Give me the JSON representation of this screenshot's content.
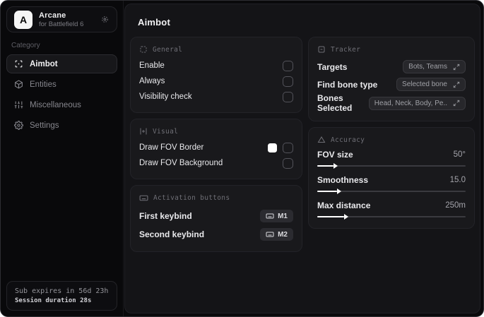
{
  "app": {
    "name": "Arcane",
    "subtitle": "for Battlefield 6",
    "logo_letter": "A"
  },
  "sidebar": {
    "category_label": "Category",
    "items": [
      {
        "label": "Aimbot",
        "icon": "crosshair-scan-icon",
        "active": true
      },
      {
        "label": "Entities",
        "icon": "cube-icon",
        "active": false
      },
      {
        "label": "Miscellaneous",
        "icon": "sliders-icon",
        "active": false
      },
      {
        "label": "Settings",
        "icon": "gear-icon",
        "active": false
      }
    ],
    "subscription": {
      "expires_text": "Sub expires in 56d 23h",
      "session_text": "Session duration 28s"
    }
  },
  "main": {
    "title": "Aimbot",
    "general": {
      "title": "General",
      "rows": [
        {
          "label": "Enable",
          "checked": false
        },
        {
          "label": "Always",
          "checked": false
        },
        {
          "label": "Visibility check",
          "checked": false
        }
      ]
    },
    "visual": {
      "title": "Visual",
      "rows": [
        {
          "label": "Draw FOV Border",
          "swatch_color": "#ffffff",
          "checked": false
        },
        {
          "label": "Draw FOV Background",
          "checked": false
        }
      ]
    },
    "activation": {
      "title": "Activation buttons",
      "rows": [
        {
          "label": "First keybind",
          "key": "M1"
        },
        {
          "label": "Second keybind",
          "key": "M2"
        }
      ]
    },
    "tracker": {
      "title": "Tracker",
      "rows": [
        {
          "label": "Targets",
          "value": "Bots, Teams"
        },
        {
          "label": "Find bone type",
          "value": "Selected bone"
        },
        {
          "label": "Bones Selected",
          "value": "Head, Neck, Body, Pe.."
        }
      ]
    },
    "accuracy": {
      "title": "Accuracy",
      "sliders": [
        {
          "label": "FOV size",
          "value": "50°",
          "fill_pct": 14
        },
        {
          "label": "Smoothness",
          "value": "15.0",
          "fill_pct": 16
        },
        {
          "label": "Max distance",
          "value": "250m",
          "fill_pct": 21
        }
      ]
    }
  }
}
